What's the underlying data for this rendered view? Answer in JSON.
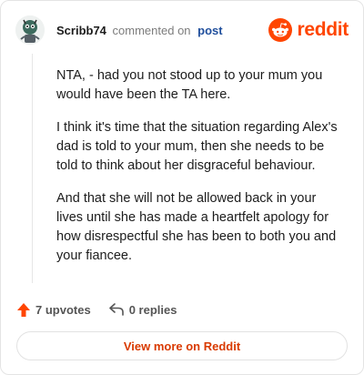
{
  "header": {
    "username": "Scribb74",
    "action": "commented on",
    "post_link": "post",
    "brand": "reddit"
  },
  "comment": {
    "paragraphs": [
      "NTA, - had you not stood up to your mum you would have been the TA here.",
      "I think it's time that the situation regarding Alex's dad is told to your mum, then she needs to be told to think about her disgraceful behaviour.",
      "And that she will not be allowed back in your lives until she has made a heartfelt apology for how disrespectful she has been to both you and your fiancee."
    ]
  },
  "stats": {
    "upvotes": "7 upvotes",
    "replies": "0 replies"
  },
  "footer": {
    "view_more": "View more on Reddit"
  },
  "colors": {
    "brand": "#ff4500",
    "link": "#1f4e9c",
    "view_more_text": "#d93a00"
  },
  "icons": [
    "avatar-icon",
    "reddit-logo-icon",
    "upvote-arrow-icon",
    "reply-arrow-icon"
  ]
}
